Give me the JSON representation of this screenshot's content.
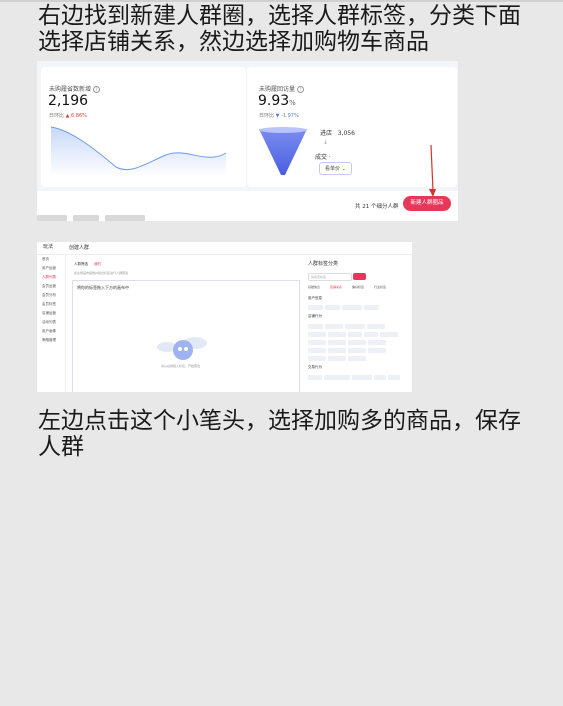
{
  "instructions": {
    "step1": "右边找到新建人群圈，选择人群标签，分类下面选择店铺关系，然边选择加购物车商品",
    "step2": "左边点击这个小笔头，选择加购多的商品，保存人群"
  },
  "shot1": {
    "left_card": {
      "label": "未购履省数新增",
      "value": "2,196",
      "compare_prefix": "日环比",
      "compare_value": "▲ 6.86%"
    },
    "right_card": {
      "label": "未购履回访量",
      "value": "9.93",
      "value_unit": "%",
      "compare_prefix": "日环比",
      "compare_value": "▼ -1.97%",
      "funnel_step1_label": "进店",
      "funnel_step1_value": "3,056",
      "funnel_step2_label": "成交",
      "select_label": "看单价"
    },
    "total_text": "共 21 个细分人群",
    "create_button": "新建人群圈品"
  },
  "shot2": {
    "logo": "玩法",
    "breadcrumb": "创建人群",
    "nav": [
      "首页",
      "用户运营",
      "人群列表",
      "会员运营",
      "会员分析",
      "会员标签",
      "店铺运营",
      "活动列表",
      "用户画像",
      "策略管理"
    ],
    "tabs": [
      "人群筛选",
      "我的"
    ],
    "hint": "在左侧画布拖拽并组合标签进行人群圈选",
    "canvas_title": "将你的标签拖入下方的画布中",
    "empty_text": "请从右侧拖入标签，开始圈选",
    "panel_title": "人群标签分类",
    "search_placeholder": "请搜索标签",
    "selects": [
      "基础信息",
      "店铺关系",
      "偏好标签",
      "行业标签"
    ],
    "sections": [
      "用户信息",
      "店铺行为",
      "交易行为"
    ]
  }
}
